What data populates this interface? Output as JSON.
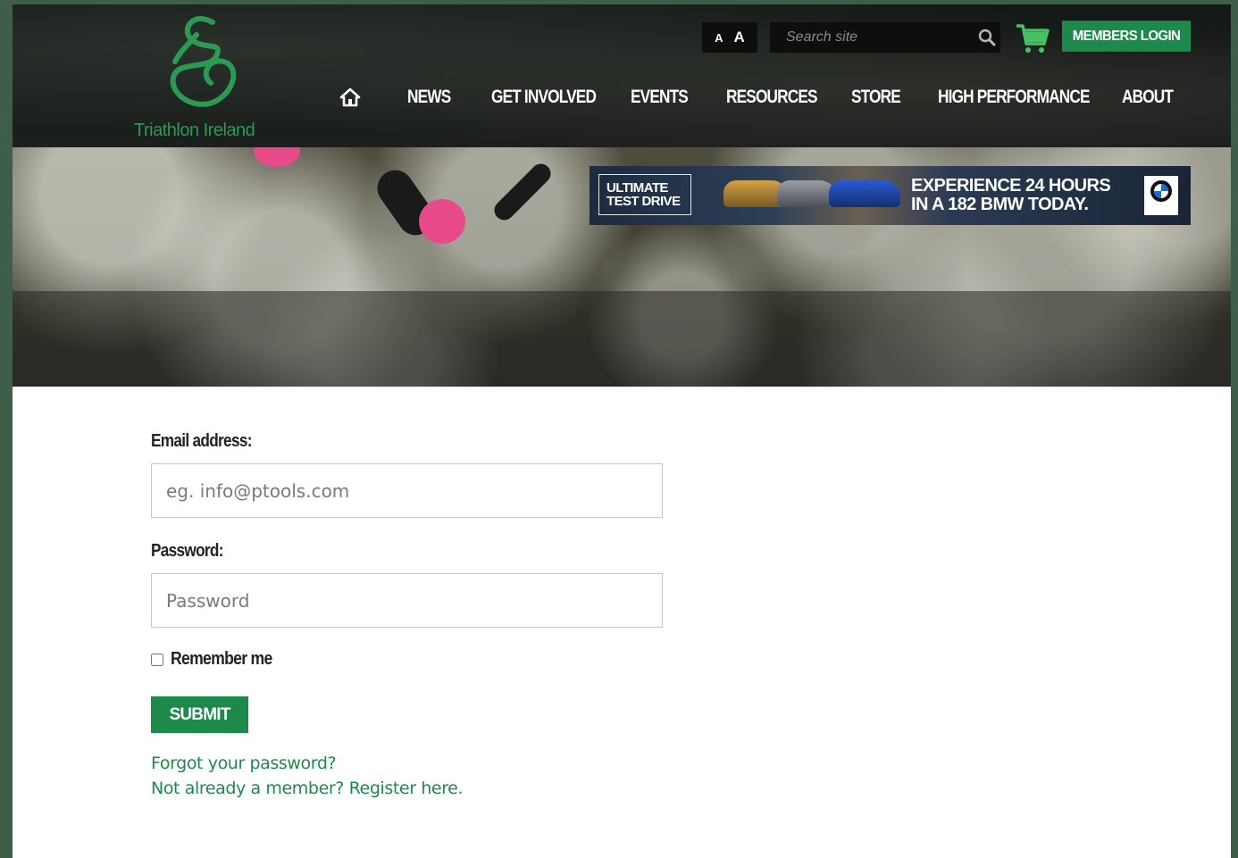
{
  "brand": {
    "name": "Triathlon Ireland",
    "color": "#2c9a55",
    "accent": "#1d8a4c"
  },
  "toolbar": {
    "font_small": "A",
    "font_large": "A",
    "search_placeholder": "Search site",
    "search_icon": "search-icon",
    "cart_icon": "shopping-cart-icon",
    "members_login_label": "MEMBERS LOGIN"
  },
  "nav": {
    "home_icon": "home-icon",
    "items": [
      {
        "label": "NEWS"
      },
      {
        "label": "GET INVOLVED"
      },
      {
        "label": "EVENTS"
      },
      {
        "label": "RESOURCES"
      },
      {
        "label": "STORE"
      },
      {
        "label": "HIGH PERFORMANCE"
      },
      {
        "label": "ABOUT"
      }
    ]
  },
  "ad": {
    "badge_line1": "ULTIMATE",
    "badge_line2": "TEST DRIVE",
    "headline_line1": "EXPERIENCE 24 HOURS",
    "headline_line2": "IN A 182 BMW TODAY."
  },
  "form": {
    "email_label": "Email address:",
    "email_placeholder": "eg. info@ptools.com",
    "email_value": "",
    "password_label": "Password:",
    "password_placeholder": "Password",
    "password_value": "",
    "remember_label": "Remember me",
    "remember_checked": false,
    "submit_label": "SUBMIT",
    "forgot_link": "Forgot your password?",
    "register_link": "Not already a member? Register here."
  }
}
